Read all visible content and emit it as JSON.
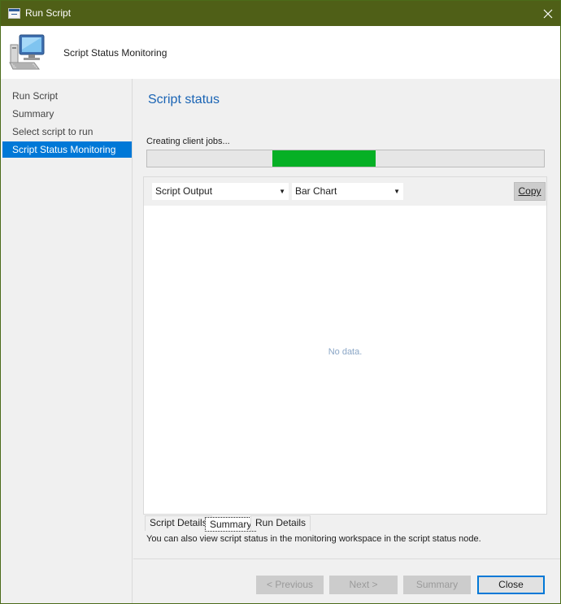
{
  "window": {
    "title": "Run Script",
    "accent_color": "#4f5f17",
    "close_icon": "close-icon"
  },
  "header": {
    "title": "Script Status Monitoring",
    "icon": "computer-icon"
  },
  "sidebar": {
    "items": [
      {
        "label": "Run Script",
        "active": false
      },
      {
        "label": "Summary",
        "active": false
      },
      {
        "label": "Select script to run",
        "active": false
      },
      {
        "label": "Script Status Monitoring",
        "active": true
      }
    ]
  },
  "main": {
    "heading": "Script status",
    "status_text": "Creating client jobs...",
    "progress_color": "#06b025",
    "output_dropdown": {
      "selected": "Script Output"
    },
    "chart_dropdown": {
      "selected": "Bar Chart"
    },
    "copy_label": "Copy",
    "empty_text": "No data.",
    "tabs": [
      {
        "label": "Script Details",
        "active": false
      },
      {
        "label": "Summary",
        "active": true
      },
      {
        "label": "Run Details",
        "active": false
      }
    ],
    "info_text": "You can also view script status in the monitoring workspace in the script status node."
  },
  "footer": {
    "previous_label": "< Previous",
    "next_label": "Next >",
    "summary_label": "Summary",
    "close_label": "Close"
  }
}
